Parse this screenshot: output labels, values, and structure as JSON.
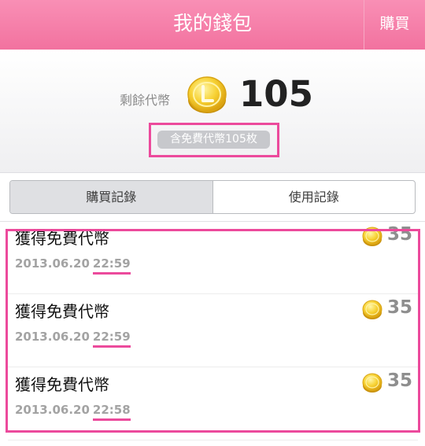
{
  "header": {
    "title": "我的錢包",
    "buy_label": "購買"
  },
  "summary": {
    "remain_label": "剩餘代幣",
    "coin_count": "105",
    "free_note": "含免費代幣105枚"
  },
  "tabs": [
    {
      "label": "購買記錄",
      "active": true
    },
    {
      "label": "使用記錄",
      "active": false
    }
  ],
  "records": [
    {
      "title": "獲得免費代幣",
      "date": "2013.06.20",
      "time": "22:59",
      "amount": "35"
    },
    {
      "title": "獲得免費代幣",
      "date": "2013.06.20",
      "time": "22:59",
      "amount": "35"
    },
    {
      "title": "獲得免費代幣",
      "date": "2013.06.20",
      "time": "22:58",
      "amount": "35"
    }
  ],
  "colors": {
    "header": "#f2729f",
    "highlight": "#ec4a9c",
    "coin": "#f4c21b"
  },
  "icons": {
    "coin": "coin-icon"
  }
}
